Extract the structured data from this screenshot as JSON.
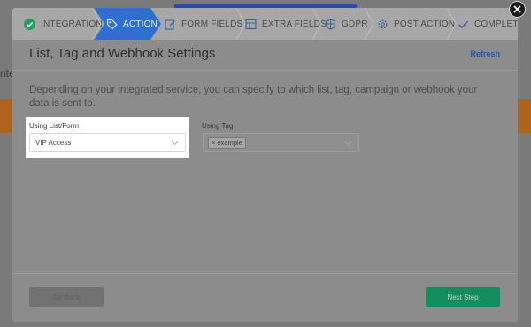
{
  "background": {
    "left_text": "nte"
  },
  "steps": [
    {
      "label": "INTEGRATION",
      "icon": "check-circle-icon",
      "state": "done"
    },
    {
      "label": "ACTION",
      "icon": "tag-icon",
      "state": "active"
    },
    {
      "label": "FORM FIELDS",
      "icon": "edit-icon",
      "state": "upcoming"
    },
    {
      "label": "EXTRA FIELDS",
      "icon": "table-icon",
      "state": "upcoming"
    },
    {
      "label": "GDPR",
      "icon": "shield-icon",
      "state": "upcoming"
    },
    {
      "label": "POST ACTION",
      "icon": "gear-icon",
      "state": "upcoming"
    },
    {
      "label": "COMPLETE",
      "icon": "check-icon",
      "state": "upcoming"
    }
  ],
  "header": {
    "title": "List, Tag and Webhook Settings",
    "refresh": "Refresh"
  },
  "description": "Depending on your integrated service, you can specify to which list, tag, campaign or webhook your data is sent to.",
  "list_field": {
    "label": "Using List/Form",
    "value": "VIP Access"
  },
  "tag_field": {
    "label": "Using Tag",
    "tags": [
      "example"
    ],
    "remove_glyph": "×"
  },
  "footer": {
    "back": "Go Back",
    "next": "Next Step"
  },
  "colors": {
    "active_step": "#2f6fd2",
    "done_check": "#1e9e5e",
    "next_button": "#138d5e",
    "refresh_link": "#2b54a3"
  }
}
